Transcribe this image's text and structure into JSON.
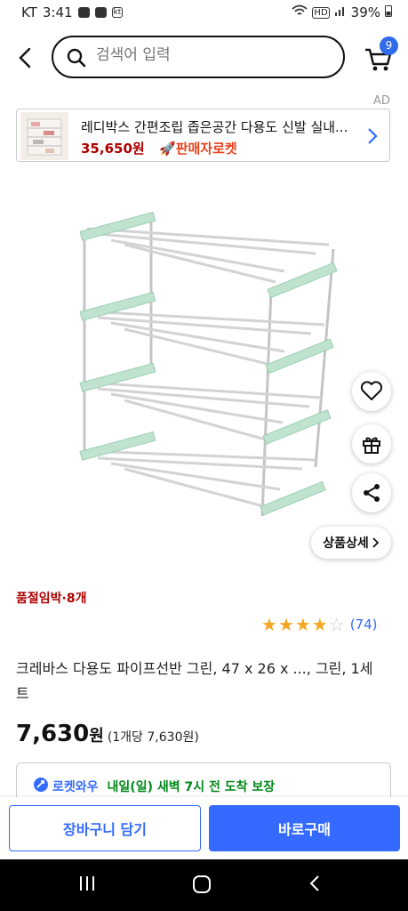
{
  "status": {
    "carrier": "KT",
    "time": "3:41",
    "battery": "39%"
  },
  "search": {
    "placeholder": "검색어 입력"
  },
  "cart": {
    "count": "9"
  },
  "ad": {
    "label": "AD",
    "title": "레디박스 간편조립 좁은공간 다용도 신발 실내...",
    "price": "35,650원",
    "rocket_label": "판매자로켓"
  },
  "product": {
    "urgency": "품절임박·8개",
    "rating": 4,
    "review_count": "(74)",
    "name": "크레바스 다용도 파이프선반 그린, 47 x 26 x ..., 그린, 1세트",
    "price": "7,630",
    "currency": "원",
    "unit_price": "(1개당 7,630원)",
    "detail_button": "상품상세"
  },
  "delivery": {
    "brand": "로켓와우",
    "promise": "내일(일) 새벽 7시 전 도착 보장"
  },
  "actions": {
    "cart_button": "장바구니 담기",
    "buy_button": "바로구매"
  },
  "colors": {
    "accent": "#346aff",
    "price_red": "#ae0000",
    "rack_green": "#bfe3cf",
    "star": "#f5a623"
  }
}
